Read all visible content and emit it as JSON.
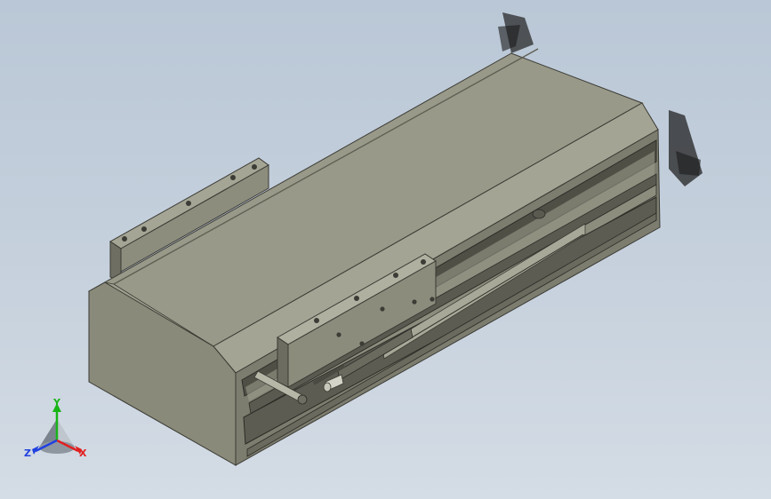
{
  "viewport": {
    "background_top": "#bac7d6",
    "background_bottom": "#d4dce5"
  },
  "model": {
    "body_color": "#8b8b7b",
    "top_color": "#9a9a8a",
    "dark_color": "#55554b",
    "highlight_color": "#b3b3a4"
  },
  "triad": {
    "x_label": "X",
    "y_label": "Y",
    "z_label": "Z",
    "x_color": "#e02020",
    "y_color": "#18b418",
    "z_color": "#2040e0"
  }
}
